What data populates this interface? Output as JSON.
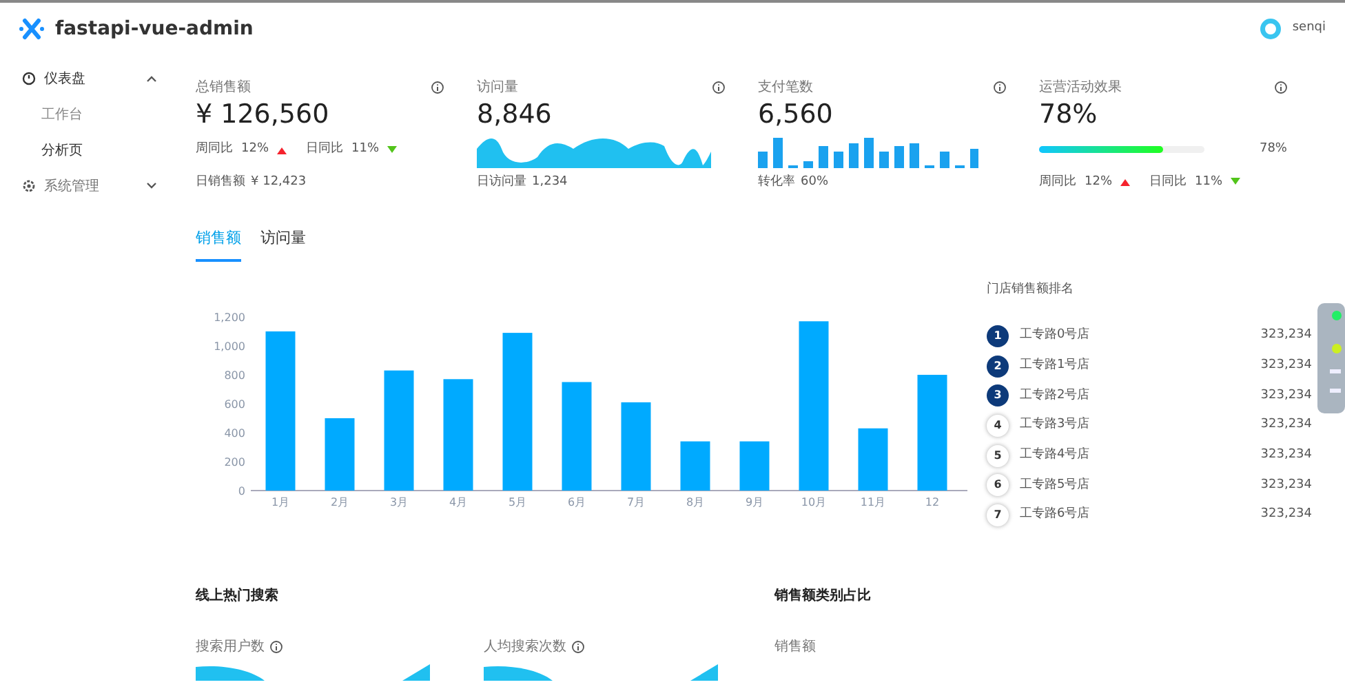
{
  "app": {
    "title": "fastapi-vue-admin",
    "user": "senqi"
  },
  "sidebar": {
    "items": [
      {
        "label": "仪表盘",
        "expanded": true,
        "children": [
          {
            "label": "工作台",
            "selected": false
          },
          {
            "label": "分析页",
            "selected": true
          }
        ]
      },
      {
        "label": "系统管理",
        "expanded": false
      }
    ]
  },
  "stats": [
    {
      "kind": "compare",
      "title": "总销售额",
      "value": "¥ 126,560",
      "compare": [
        {
          "label": "周同比",
          "value": "12%",
          "rising": true
        },
        {
          "label": "日同比",
          "value": "11%",
          "rising": false
        }
      ],
      "footer_label": "日销售额",
      "footer_value": "¥ 12,423"
    },
    {
      "kind": "area",
      "title": "访问量",
      "value": "8,846",
      "footer_label": "日访问量",
      "footer_value": "1,234"
    },
    {
      "kind": "bars",
      "title": "支付笔数",
      "value": "6,560",
      "footer_label": "转化率",
      "footer_value": "60%"
    },
    {
      "kind": "progress",
      "title": "运营活动效果",
      "value": "78%",
      "level": 0.78,
      "reading": "78%",
      "compare": [
        {
          "label": "周同比",
          "value": "12%",
          "rising": true
        },
        {
          "label": "日同比",
          "value": "11%",
          "rising": false
        }
      ]
    }
  ],
  "tabs": [
    {
      "label": "销售额",
      "selected": true
    },
    {
      "label": "访问量",
      "selected": false
    }
  ],
  "sales_chart": {
    "chart_data": {
      "type": "bar",
      "categories": [
        "1月",
        "2月",
        "3月",
        "4月",
        "5月",
        "6月",
        "7月",
        "8月",
        "9月",
        "10月",
        "11月",
        "12"
      ],
      "series": [
        {
          "color": "#00aaff",
          "values": [
            1100,
            500,
            830,
            770,
            1090,
            750,
            610,
            340,
            340,
            1170,
            430,
            800
          ]
        }
      ],
      "ylim": [
        0,
        1200
      ],
      "yticks": [
        0,
        200,
        400,
        600,
        800,
        {
          "value": 1000,
          "label": "1,000"
        },
        {
          "value": 1200,
          "label": "1,200"
        }
      ]
    }
  },
  "ranking": {
    "title": "门店销售额排名",
    "items": [
      {
        "rank": "1",
        "name": "工专路0号店",
        "value": "323,234",
        "highlighted": true
      },
      {
        "rank": "2",
        "name": "工专路1号店",
        "value": "323,234",
        "highlighted": true
      },
      {
        "rank": "3",
        "name": "工专路2号店",
        "value": "323,234",
        "highlighted": true
      },
      {
        "rank": "4",
        "name": "工专路3号店",
        "value": "323,234",
        "highlighted": false
      },
      {
        "rank": "5",
        "name": "工专路4号店",
        "value": "323,234",
        "highlighted": false
      },
      {
        "rank": "6",
        "name": "工专路5号店",
        "value": "323,234",
        "highlighted": false
      },
      {
        "rank": "7",
        "name": "工专路6号店",
        "value": "323,234",
        "highlighted": false
      }
    ]
  },
  "search": {
    "title": "线上热门搜索",
    "metrics": [
      "搜索用户数",
      "人均搜索次数"
    ]
  },
  "category": {
    "title": "销售额类别占比",
    "subtitle": "销售额"
  }
}
